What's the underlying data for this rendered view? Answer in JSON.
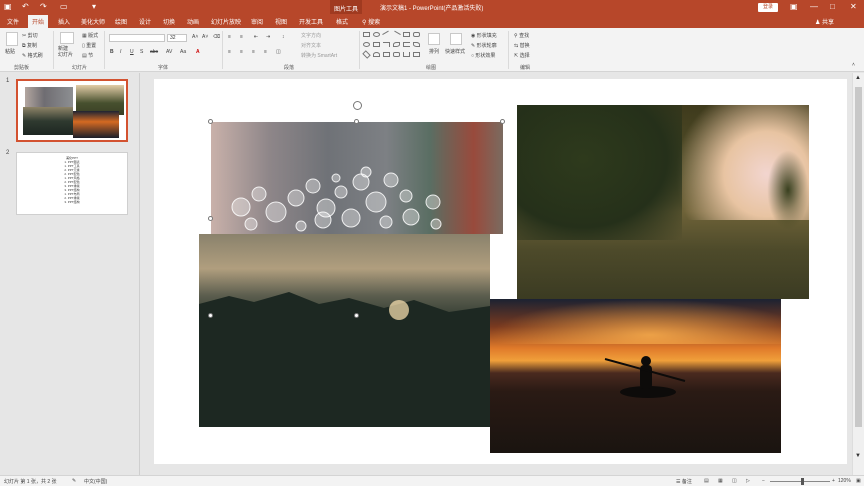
{
  "window": {
    "title": "演示文稿1 - PowerPoint(产品激活失败)",
    "contextual_tab": "图片工具",
    "login_button": "登录",
    "minimize": "—",
    "restore": "□",
    "close": "✕",
    "ribbon_options": "▣"
  },
  "quick_access": {
    "save": "▣",
    "undo": "↶",
    "redo": "↷",
    "present": "▭",
    "customize": "▾"
  },
  "tabs": [
    "文件",
    "开始",
    "插入",
    "美化大师",
    "绘图",
    "设计",
    "切换",
    "动画",
    "幻灯片放映",
    "审阅",
    "视图",
    "开发工具",
    "格式"
  ],
  "active_tab": "开始",
  "tell_me": "搜索",
  "share": "共享",
  "ribbon": {
    "clipboard": {
      "label": "剪贴板",
      "paste": "粘贴",
      "cut": "剪切",
      "copy": "复制",
      "format_painter": "格式刷"
    },
    "slides": {
      "label": "幻灯片",
      "new_slide": "新建\n幻灯片",
      "layout": "版式",
      "reset": "重置",
      "section": "节"
    },
    "font": {
      "label": "字体",
      "font_name": "",
      "font_size": "32",
      "bold": "B",
      "italic": "I",
      "underline": "U",
      "shadow": "S",
      "strikethrough": "abc",
      "spacing": "AV",
      "case": "Aa",
      "color": "A"
    },
    "paragraph": {
      "label": "段落",
      "text_direction": "文字方向",
      "align_text": "对齐文本",
      "convert_smartart": "转换为 SmartArt"
    },
    "drawing": {
      "label": "绘图",
      "arrange": "排列",
      "quick_styles": "快速样式",
      "shape_fill": "形状填充",
      "shape_outline": "形状轮廓",
      "shape_effects": "形状效果"
    },
    "editing": {
      "label": "编辑",
      "find": "查找",
      "replace": "替换",
      "select": "选择"
    }
  },
  "slides_pane": {
    "slide1_num": "1",
    "slide2_num": "2",
    "slide2_outline": [
      "美化PPT",
      "1. PPT图表",
      "1. PPT工具",
      "2. PPT元素",
      "2. PPT配色",
      "1. PPT风格",
      "2. PPT配色",
      "3. PPT排版",
      "3. PPT结构",
      "1. PPT布局",
      "2. PPT排版",
      "3. PPT结构"
    ]
  },
  "status": {
    "slide_count": "幻灯片 第 1 张，共 2 张",
    "language": "中文(中国)",
    "notes": "备注",
    "zoom": "120%",
    "zoom_minus": "−",
    "zoom_plus": "+"
  },
  "colors": {
    "accent": "#b7472a",
    "selected_thumb_border": "#d35230"
  }
}
